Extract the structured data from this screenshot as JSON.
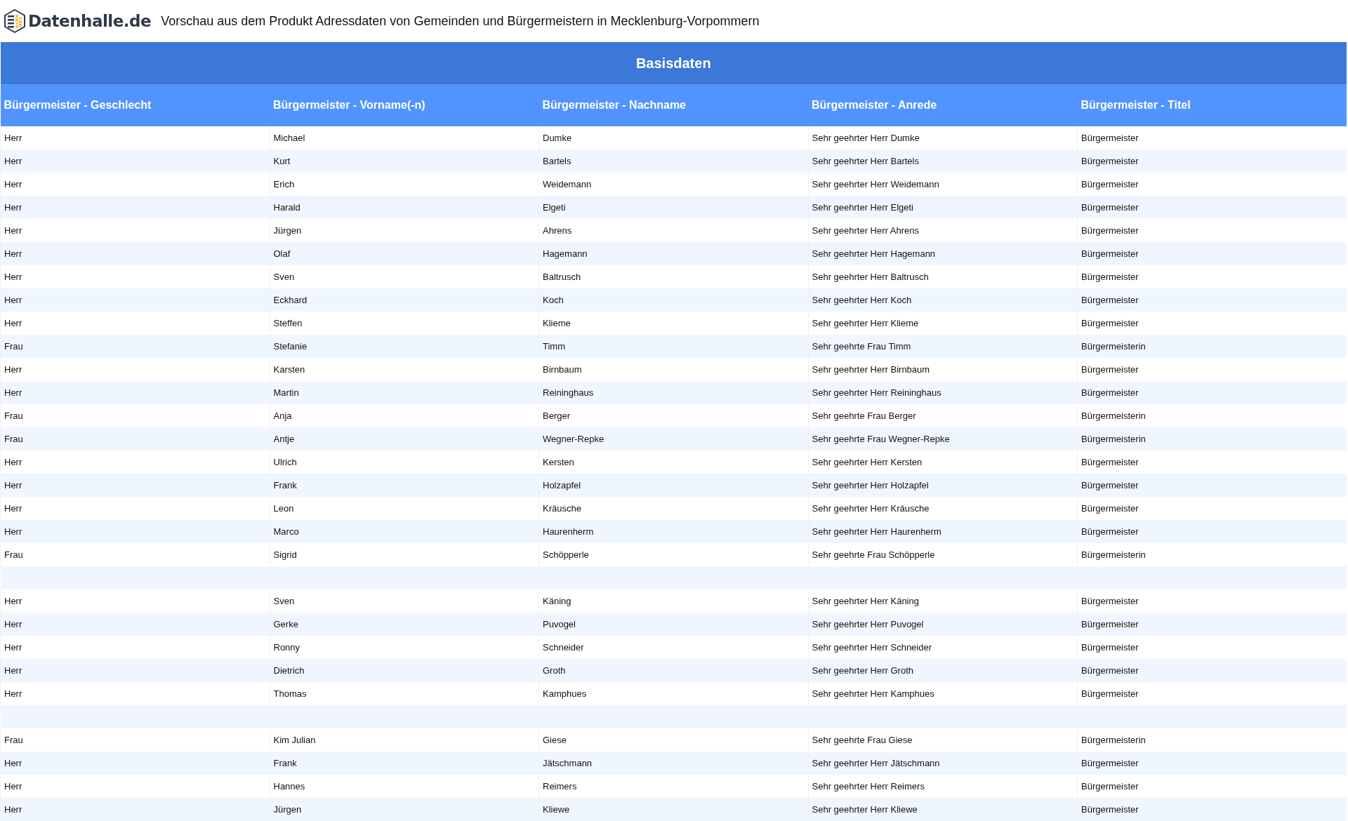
{
  "header": {
    "logo_text": "Datenhalle.de",
    "title": "Vorschau aus dem Produkt Adressdaten von Gemeinden und Bürgermeistern in Mecklenburg-Vorpommern"
  },
  "table": {
    "group_title": "Basisdaten",
    "columns": [
      "Bürgermeister - Geschlecht",
      "Bürgermeister - Vorname(-n)",
      "Bürgermeister - Nachname",
      "Bürgermeister - Anrede",
      "Bürgermeister - Titel"
    ],
    "rows": [
      {
        "kind": "data",
        "cells": [
          "Herr",
          "Michael",
          "Dumke",
          "Sehr geehrter Herr Dumke",
          "Bürgermeister"
        ]
      },
      {
        "kind": "data",
        "cells": [
          "Herr",
          "Kurt",
          "Bartels",
          "Sehr geehrter Herr Bartels",
          "Bürgermeister"
        ]
      },
      {
        "kind": "data",
        "cells": [
          "Herr",
          "Erich",
          "Weidemann",
          "Sehr geehrter Herr Weidemann",
          "Bürgermeister"
        ]
      },
      {
        "kind": "data",
        "cells": [
          "Herr",
          "Harald",
          "Elgeti",
          "Sehr geehrter Herr Elgeti",
          "Bürgermeister"
        ]
      },
      {
        "kind": "data",
        "cells": [
          "Herr",
          "Jürgen",
          "Ahrens",
          "Sehr geehrter Herr Ahrens",
          "Bürgermeister"
        ]
      },
      {
        "kind": "data",
        "cells": [
          "Herr",
          "Olaf",
          "Hagemann",
          "Sehr geehrter Herr Hagemann",
          "Bürgermeister"
        ]
      },
      {
        "kind": "data",
        "cells": [
          "Herr",
          "Sven",
          "Baltrusch",
          "Sehr geehrter Herr Baltrusch",
          "Bürgermeister"
        ]
      },
      {
        "kind": "data",
        "cells": [
          "Herr",
          "Eckhard",
          "Koch",
          "Sehr geehrter Herr Koch",
          "Bürgermeister"
        ]
      },
      {
        "kind": "data",
        "cells": [
          "Herr",
          "Steffen",
          "Klieme",
          "Sehr geehrter Herr Klieme",
          "Bürgermeister"
        ]
      },
      {
        "kind": "data",
        "cells": [
          "Frau",
          "Stefanie",
          "Timm",
          "Sehr geehrte Frau Timm",
          "Bürgermeisterin"
        ]
      },
      {
        "kind": "data",
        "cells": [
          "Herr",
          "Karsten",
          "Birnbaum",
          "Sehr geehrter Herr Birnbaum",
          "Bürgermeister"
        ]
      },
      {
        "kind": "data",
        "cells": [
          "Herr",
          "Martin",
          "Reininghaus",
          "Sehr geehrter Herr Reininghaus",
          "Bürgermeister"
        ]
      },
      {
        "kind": "data",
        "cells": [
          "Frau",
          "Anja",
          "Berger",
          "Sehr geehrte Frau Berger",
          "Bürgermeisterin"
        ]
      },
      {
        "kind": "data",
        "cells": [
          "Frau",
          "Antje",
          "Wegner-Repke",
          "Sehr geehrte Frau Wegner-Repke",
          "Bürgermeisterin"
        ]
      },
      {
        "kind": "data",
        "cells": [
          "Herr",
          "Ulrich",
          "Kersten",
          "Sehr geehrter Herr Kersten",
          "Bürgermeister"
        ]
      },
      {
        "kind": "data",
        "cells": [
          "Herr",
          "Frank",
          "Holzapfel",
          "Sehr geehrter Herr Holzapfel",
          "Bürgermeister"
        ]
      },
      {
        "kind": "data",
        "cells": [
          "Herr",
          "Leon",
          "Kräusche",
          "Sehr geehrter Herr Kräusche",
          "Bürgermeister"
        ]
      },
      {
        "kind": "data",
        "cells": [
          "Herr",
          "Marco",
          "Haurenherm",
          "Sehr geehrter Herr Haurenherm",
          "Bürgermeister"
        ]
      },
      {
        "kind": "data",
        "cells": [
          "Frau",
          "Sigrid",
          "Schöpperle",
          "Sehr geehrte Frau Schöpperle",
          "Bürgermeisterin"
        ]
      },
      {
        "kind": "blank"
      },
      {
        "kind": "data",
        "cells": [
          "Herr",
          "Sven",
          "Käning",
          "Sehr geehrter Herr Käning",
          "Bürgermeister"
        ]
      },
      {
        "kind": "data",
        "cells": [
          "Herr",
          "Gerke",
          "Puvogel",
          "Sehr geehrter Herr Puvogel",
          "Bürgermeister"
        ]
      },
      {
        "kind": "data",
        "cells": [
          "Herr",
          "Ronny",
          "Schneider",
          "Sehr geehrter Herr Schneider",
          "Bürgermeister"
        ]
      },
      {
        "kind": "data",
        "cells": [
          "Herr",
          "Dietrich",
          "Groth",
          "Sehr geehrter Herr Groth",
          "Bürgermeister"
        ]
      },
      {
        "kind": "data",
        "cells": [
          "Herr",
          "Thomas",
          "Kamphues",
          "Sehr geehrter Herr Kamphues",
          "Bürgermeister"
        ]
      },
      {
        "kind": "blank"
      },
      {
        "kind": "data",
        "cells": [
          "Frau",
          "Kim Julian",
          "Giese",
          "Sehr geehrte Frau Giese",
          "Bürgermeisterin"
        ]
      },
      {
        "kind": "data",
        "cells": [
          "Herr",
          "Frank",
          "Jätschmann",
          "Sehr geehrter Herr Jätschmann",
          "Bürgermeister"
        ]
      },
      {
        "kind": "data",
        "cells": [
          "Herr",
          "Hannes",
          "Reimers",
          "Sehr geehrter Herr Reimers",
          "Bürgermeister"
        ]
      },
      {
        "kind": "data",
        "cells": [
          "Herr",
          "Jürgen",
          "Kliewe",
          "Sehr geehrter Herr Kliewe",
          "Bürgermeister"
        ]
      }
    ]
  }
}
